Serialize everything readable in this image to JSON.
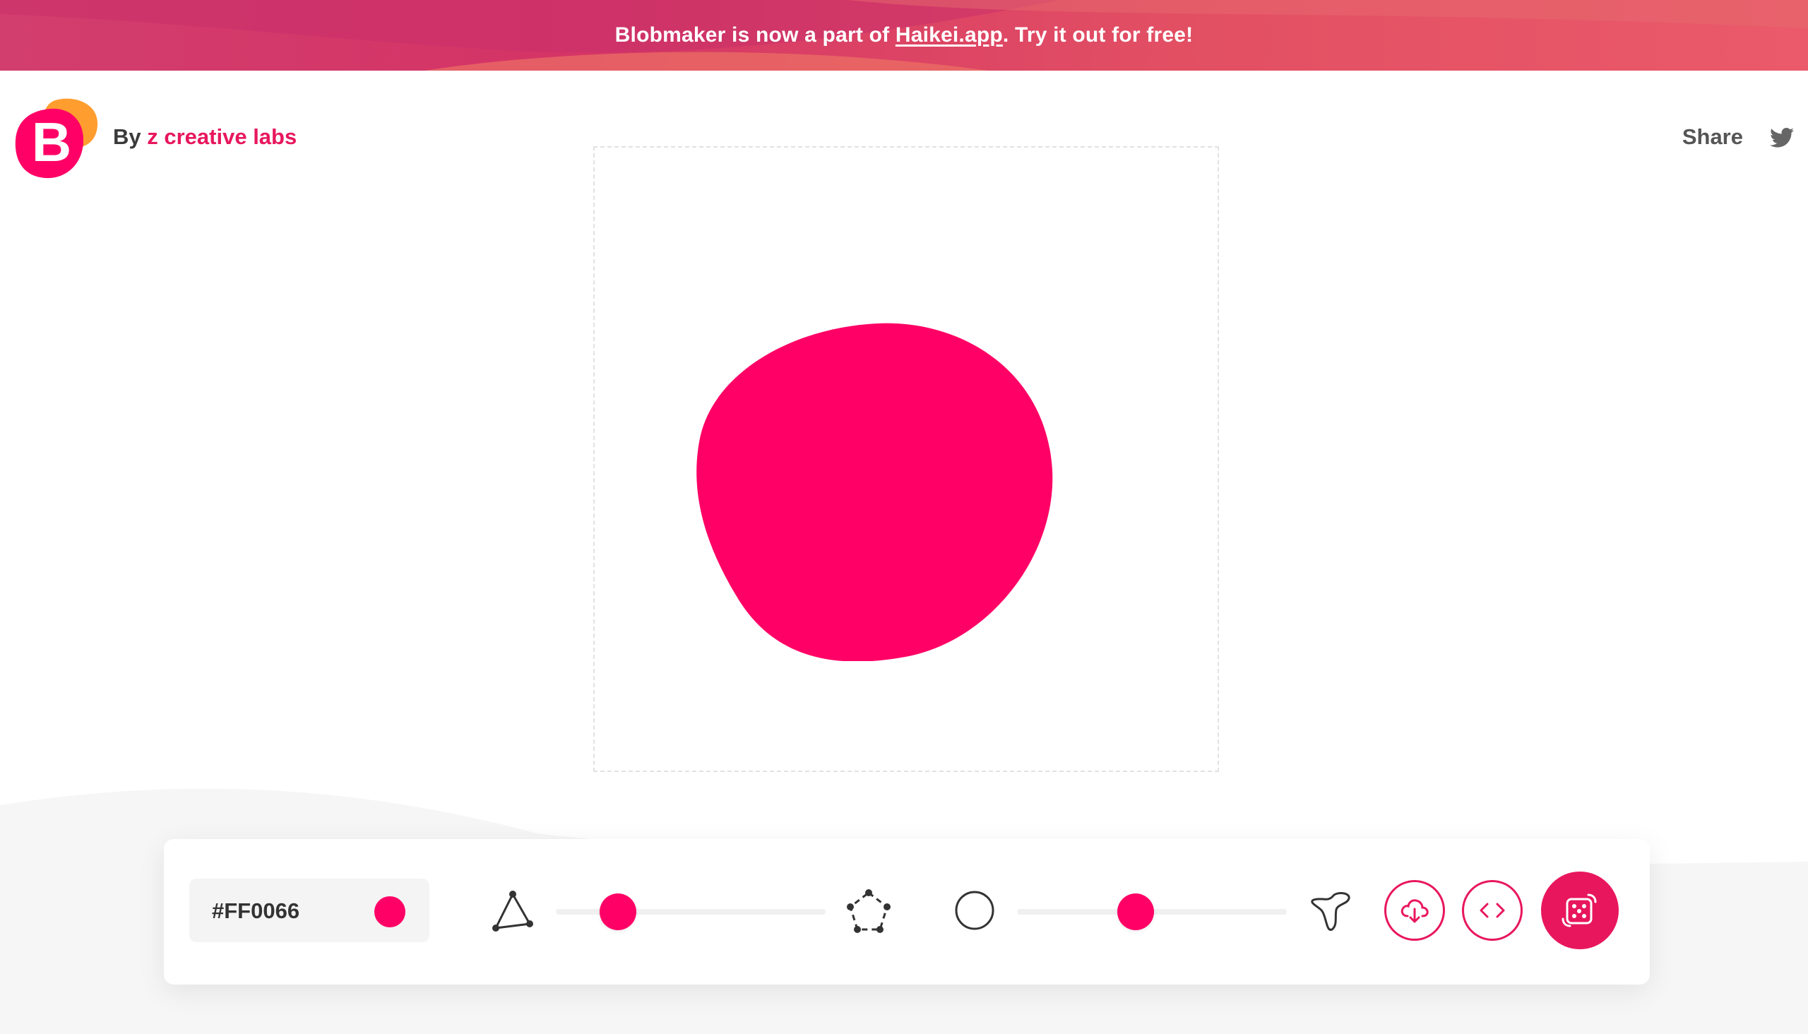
{
  "banner": {
    "text_before": "Blobmaker is now a part of ",
    "link_text": "Haikei.app",
    "text_after": ". Try it out for free!"
  },
  "header": {
    "by_label": "By",
    "author_link": "z creative labs",
    "share_label": "Share",
    "logo_letter": "B"
  },
  "toolbar": {
    "color_value": "#FF0066",
    "complexity_level": 0.23,
    "contrast_level": 0.44
  },
  "colors": {
    "blob": "#ff0066",
    "accent": "#e8175d",
    "logo_orange": "#ff9d2e"
  },
  "icons": {
    "complexity_min": "triangle-icon",
    "complexity_max": "pentagon-icon",
    "contrast_min": "circle-icon",
    "contrast_max": "star-blob-icon",
    "download": "download-cloud-icon",
    "code": "code-icon",
    "random": "dice-icon",
    "share": "twitter-icon"
  }
}
